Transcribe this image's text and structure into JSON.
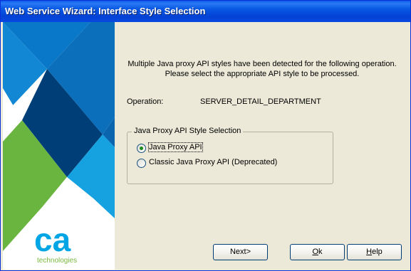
{
  "window": {
    "title": "Web Service Wizard: Interface Style Selection"
  },
  "brand": {
    "logo_text": "ca",
    "logo_subtext": "technologies",
    "colors": {
      "blue": "#0a78c8",
      "dark_blue": "#003e78",
      "green": "#68b23f",
      "light_blue": "#16a1e0"
    }
  },
  "message": {
    "line1": "Multiple Java proxy API styles have been detected for the following operation.",
    "line2": "Please select the appropriate API style to be processed."
  },
  "operation": {
    "label": "Operation:",
    "value": "SERVER_DETAIL_DEPARTMENT"
  },
  "style_selection": {
    "legend": "Java Proxy API Style Selection",
    "options": [
      {
        "label": "Java Proxy API",
        "selected": true
      },
      {
        "label": "Classic Java Proxy API (Deprecated)",
        "selected": false
      }
    ]
  },
  "buttons": {
    "next": "Next>",
    "ok_first": "O",
    "ok_rest": "k",
    "help_first": "H",
    "help_rest": "elp"
  }
}
